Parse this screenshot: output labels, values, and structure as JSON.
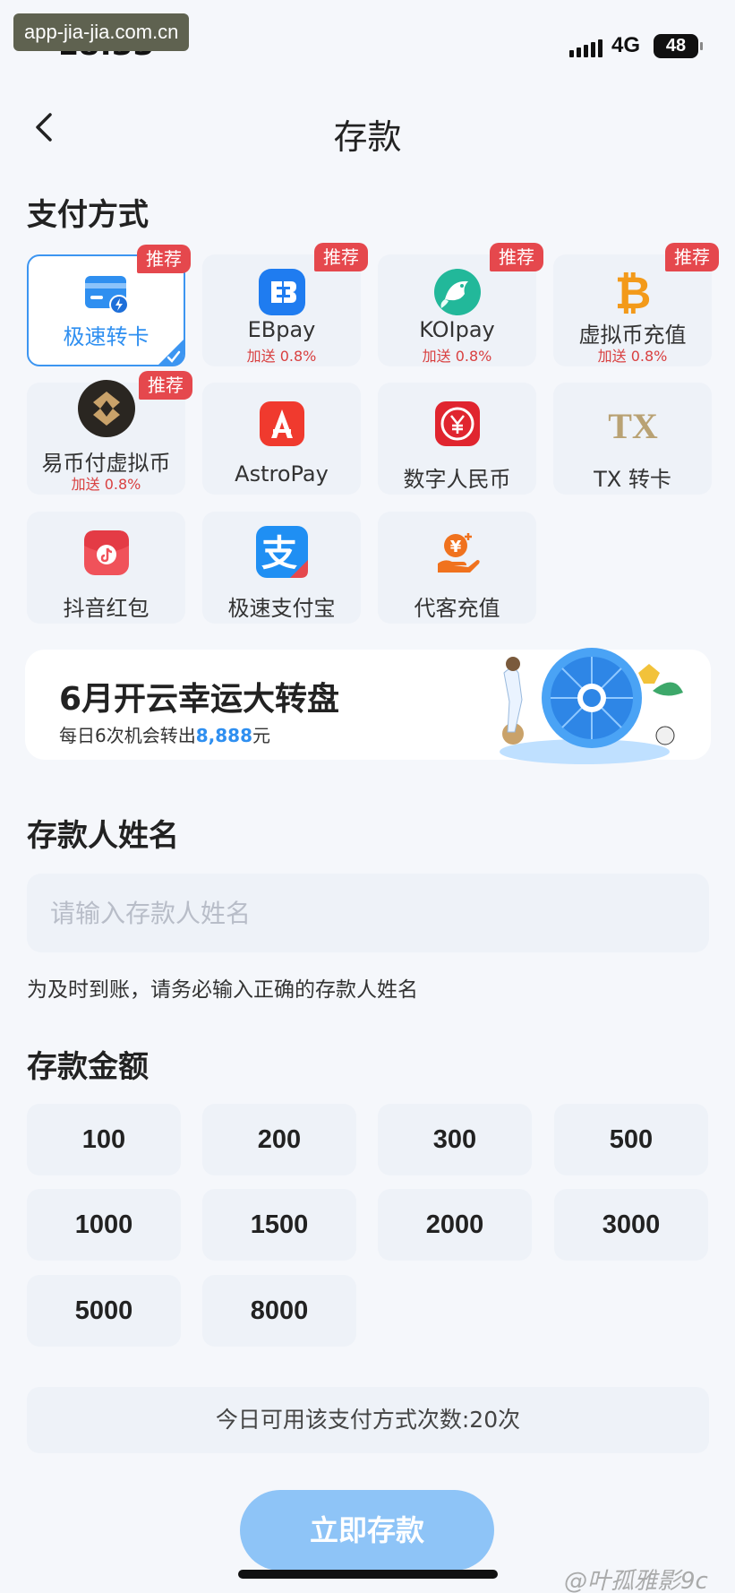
{
  "status_bar": {
    "time": "18:33",
    "watermark": "app-jia-jia.com.cn",
    "network": "4G",
    "battery": "48"
  },
  "nav": {
    "title": "存款"
  },
  "payment_section": {
    "title": "支付方式"
  },
  "methods": [
    {
      "label": "极速转卡",
      "bonus": "",
      "badge": "推荐",
      "icon": "bank-card-flash-icon",
      "selected": true
    },
    {
      "label": "EBpay",
      "bonus": "加送 0.8%",
      "badge": "推荐",
      "icon": "ebpay-icon"
    },
    {
      "label": "KOIpay",
      "bonus": "加送 0.8%",
      "badge": "推荐",
      "icon": "koi-fish-icon"
    },
    {
      "label": "虚拟币充值",
      "bonus": "加送 0.8%",
      "badge": "推荐",
      "icon": "bitcoin-icon"
    },
    {
      "label": "易币付虚拟币",
      "bonus": "加送 0.8%",
      "badge": "推荐",
      "icon": "ebipay-icon"
    },
    {
      "label": "AstroPay",
      "bonus": "",
      "badge": "",
      "icon": "astropay-icon"
    },
    {
      "label": "数字人民币",
      "bonus": "",
      "badge": "",
      "icon": "digital-rmb-icon"
    },
    {
      "label": "TX 转卡",
      "bonus": "",
      "badge": "",
      "icon": "tx-logo-icon"
    },
    {
      "label": "抖音红包",
      "bonus": "",
      "badge": "",
      "icon": "douyin-red-packet-icon"
    },
    {
      "label": "极速支付宝",
      "bonus": "",
      "badge": "",
      "icon": "alipay-icon"
    },
    {
      "label": "代客充值",
      "bonus": "",
      "badge": "",
      "icon": "agent-topup-icon"
    }
  ],
  "banner": {
    "title": "6月开云幸运大转盘",
    "subtitle_prefix": "每日6次机会转出",
    "subtitle_amount": "8,888",
    "subtitle_suffix": "元"
  },
  "depositor": {
    "title": "存款人姓名",
    "placeholder": "请输入存款人姓名",
    "value": "",
    "hint": "为及时到账，请务必输入正确的存款人姓名"
  },
  "amount_section": {
    "title": "存款金额",
    "amounts": [
      "100",
      "200",
      "300",
      "500",
      "1000",
      "1500",
      "2000",
      "3000",
      "5000",
      "8000"
    ]
  },
  "limit_text": "今日可用该支付方式次数:20次",
  "submit_label": "立即存款",
  "watermark_bottom": "@叶孤雅影9c",
  "colors": {
    "accent": "#2f8ff0",
    "badge": "#e5484d",
    "button": "#8ec4f7"
  }
}
